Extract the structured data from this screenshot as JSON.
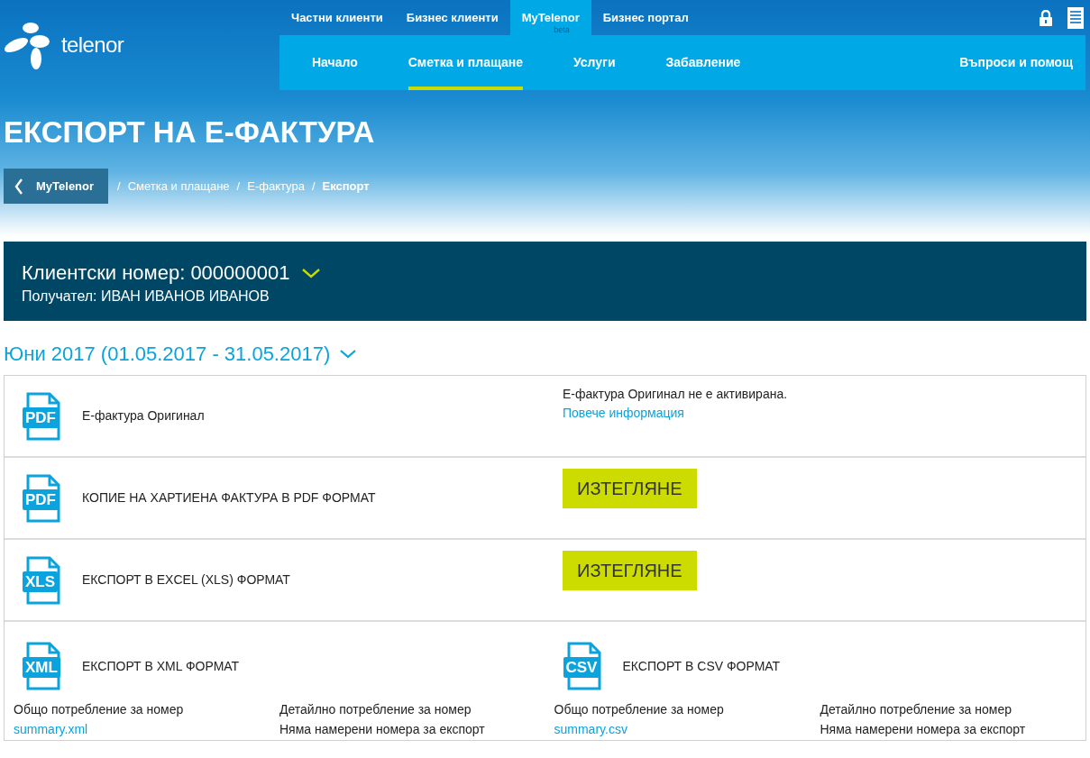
{
  "header": {
    "logo": "telenor",
    "top_nav": [
      {
        "label": "Частни клиенти",
        "selected": false
      },
      {
        "label": "Бизнес клиенти",
        "selected": false
      },
      {
        "label": "MyTelenor",
        "badge": "beta",
        "selected": true
      },
      {
        "label": "Бизнес портал",
        "selected": false
      }
    ],
    "main_nav": [
      {
        "label": "Начало",
        "selected": false
      },
      {
        "label": "Сметка и плащане",
        "selected": true
      },
      {
        "label": "Услуги",
        "selected": false
      },
      {
        "label": "Забавление",
        "selected": false
      }
    ],
    "help": "Въпроси и помощ"
  },
  "page_title": "ЕКСПОРТ НА Е-ФАКТУРА",
  "breadcrumb": {
    "back": "MyTelenor",
    "items": [
      {
        "separator": "/",
        "label": "Сметка и плащане",
        "current": false
      },
      {
        "separator": "/",
        "label": "Е-фактура",
        "current": false
      },
      {
        "separator": "/",
        "label": "Експорт",
        "current": true
      }
    ]
  },
  "client": {
    "number": "Клиентски номер: 000000001",
    "recipient": "Получател: ИВАН ИВАНОВ ИВАНОВ"
  },
  "period": "Юни 2017 (01.05.2017 - 31.05.2017)",
  "exports": [
    {
      "kind": "note",
      "file_type": "PDF",
      "title": "Е-фактура Оригинал",
      "note": "Е-фактура Оригинал не е активирана.",
      "link": "Повече информация"
    },
    {
      "kind": "button",
      "file_type": "PDF",
      "title": "КОПИЕ НА ХАРТИЕНА ФАКТУРА В PDF ФОРМАТ",
      "button": "ИЗТЕГЛЯНЕ"
    },
    {
      "kind": "button",
      "file_type": "XLS",
      "title": "ЕКСПОРТ В EXCEL (XLS) ФОРМАТ",
      "button": "ИЗТЕГЛЯНЕ"
    }
  ],
  "formats": [
    {
      "file_type": "XML",
      "title": "ЕКСПОРТ В XML ФОРМАТ",
      "summary_label": "Общо потребление за номер",
      "summary_link": "summary.xml",
      "detail_label": "Детайлно потребление за номер",
      "detail_note": "Няма намерени номера за експорт"
    },
    {
      "file_type": "CSV",
      "title": "ЕКСПОРТ В CSV ФОРМАТ",
      "summary_label": "Общо потребление за номер",
      "summary_link": "summary.csv",
      "detail_label": "Детайлно потребление за номер",
      "detail_note": "Няма намерени номера за експорт"
    }
  ]
}
